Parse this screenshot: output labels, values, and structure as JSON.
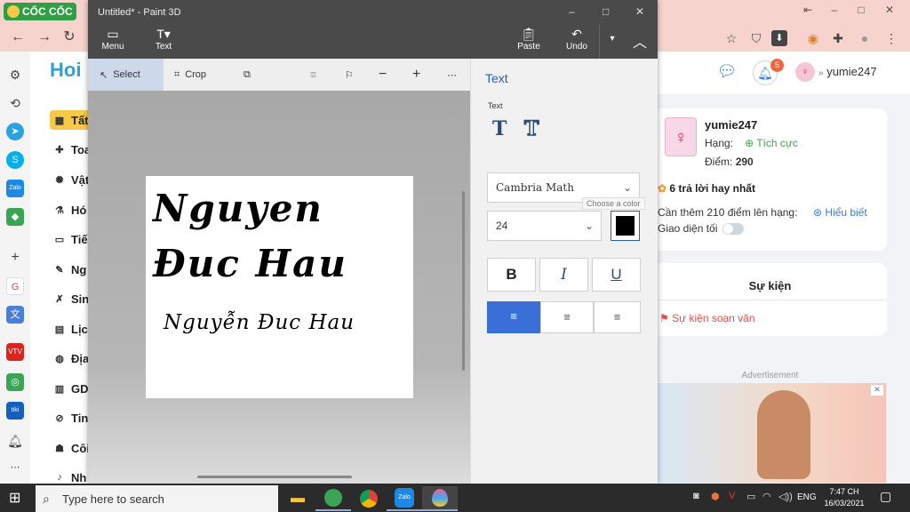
{
  "browser": {
    "brand": "CỐC CỐC",
    "window_controls": [
      "–",
      "□",
      "✕"
    ]
  },
  "paint": {
    "title": "Untitled* - Paint 3D",
    "toolbar": {
      "menu": "Menu",
      "text": "Text",
      "paste": "Paste",
      "undo": "Undo"
    },
    "subtools": {
      "select": "Select",
      "crop": "Crop"
    },
    "canvas": {
      "line1": "Nguyen",
      "line2": "Đuc Hau",
      "line3": "Nguyễn Đuc Hau"
    },
    "panel": {
      "heading": "Text",
      "text_label": "Text",
      "font": "Cambria Math",
      "size": "24",
      "color_tooltip": "Choose a color",
      "bold": "B",
      "italic": "I",
      "underline": "U",
      "text_color": "#000000"
    }
  },
  "site": {
    "username": "yumie247",
    "notif_count": "5",
    "nav": [
      "Tất",
      "Toa",
      "Vật",
      "Hó",
      "Tiế",
      "Ng",
      "Sin",
      "Lịc",
      "Địa",
      "GD",
      "Tin",
      "Côi",
      "Nh"
    ],
    "profile": {
      "name": "yumie247",
      "rank_label": "Hạng:",
      "rank_value": "Tích cực",
      "points_label": "Điểm:",
      "points_value": "290",
      "best_answers": "6 trả lời hay nhất",
      "need_more": "Cần thêm 210 điểm lên hạng:",
      "learn_more": "Hiểu biết",
      "dark_mode": "Giao diện tối"
    },
    "events": {
      "title": "Sự kiện",
      "item": "Sự kiện soạn văn"
    },
    "ad_label": "Advertisement"
  },
  "taskbar": {
    "search_placeholder": "Type here to search",
    "language": "ENG",
    "time": "7:47 CH",
    "date": "16/03/2021"
  },
  "colors": {
    "browser_chrome": "#f6d3cd",
    "paint_dark": "#4a4a4a",
    "accent_blue": "#3a6fd8",
    "nav_active": "#f7c948"
  }
}
